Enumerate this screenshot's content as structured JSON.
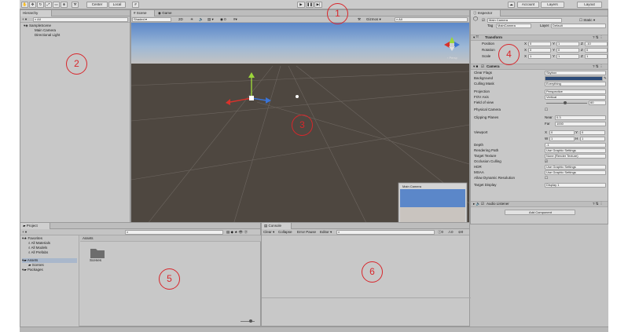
{
  "toolbar": {
    "pivot_label": "Center",
    "space_label": "Local",
    "account_label": "Account",
    "layers_label": "Layers",
    "layout_label": "Layout"
  },
  "hierarchy": {
    "tab_label": "Hierarchy",
    "create_label": "+ ▾",
    "search_placeholder": "All",
    "scene_name": "SampleScene",
    "items": [
      "Main Camera",
      "Directional Light"
    ]
  },
  "scene": {
    "tab_scene": "Scene",
    "tab_game": "Game",
    "shading_mode": "Shaded",
    "mode_2d": "2D",
    "gizmos_label": "Gizmos",
    "search_placeholder": "All",
    "persp_label": "‹ Persp",
    "camera_preview_title": "Main Camera"
  },
  "inspector": {
    "tab_label": "Inspector",
    "object_name": "Main Camera",
    "static_label": "Static",
    "tag_label": "Tag",
    "tag_value": "MainCamera",
    "layer_label": "Layer",
    "layer_value": "Default",
    "transform": {
      "title": "Transform",
      "rows": [
        {
          "label": "Position",
          "x": "0",
          "y": "1",
          "z": "-10"
        },
        {
          "label": "Rotation",
          "x": "0",
          "y": "0",
          "z": "0"
        },
        {
          "label": "Scale",
          "x": "1",
          "y": "1",
          "z": "1"
        }
      ]
    },
    "camera": {
      "title": "Camera",
      "clear_flags_label": "Clear Flags",
      "clear_flags_value": "Skybox",
      "background_label": "Background",
      "background_color": "#2b4a78",
      "culling_mask_label": "Culling Mask",
      "culling_mask_value": "Everything",
      "projection_label": "Projection",
      "projection_value": "Perspective",
      "fov_axis_label": "FOV Axis",
      "fov_axis_value": "Vertical",
      "fov_label": "Field of view",
      "fov_value": "60",
      "physical_camera_label": "Physical Camera",
      "clipping_label": "Clipping Planes",
      "near_label": "Near",
      "near_value": "0.3",
      "far_label": "Far",
      "far_value": "1000",
      "viewport_label": "Viewport",
      "vx_label": "X",
      "vx": "0",
      "vy_label": "Y",
      "vy": "0",
      "vw_label": "W",
      "vw": "1",
      "vh_label": "H",
      "vh": "1",
      "depth_label": "Depth",
      "depth_value": "-1",
      "rendering_path_label": "Rendering Path",
      "rendering_path_value": "Use Graphic Settings",
      "target_texture_label": "Target Texture",
      "target_texture_value": "None (Render Texture)",
      "occlusion_label": "Occlusion Culling",
      "hdr_label": "HDR",
      "hdr_value": "Use Graphic Settings",
      "msaa_label": "MSAA",
      "msaa_value": "Use Graphic Settings",
      "dynamic_res_label": "Allow Dynamic Resolution",
      "target_display_label": "Target Display",
      "target_display_value": "Display 1"
    },
    "audio_listener_title": "Audio Listener",
    "add_component_label": "Add Component"
  },
  "project": {
    "tab_label": "Project",
    "tree": [
      {
        "label": "Favorites",
        "indent": 0
      },
      {
        "label": "All Materials",
        "indent": 1
      },
      {
        "label": "All Models",
        "indent": 1
      },
      {
        "label": "All Prefabs",
        "indent": 1
      },
      {
        "label": "Assets",
        "indent": 0
      },
      {
        "label": "Scenes",
        "indent": 1
      },
      {
        "label": "Packages",
        "indent": 0
      }
    ],
    "assets_header": "Assets",
    "folder_name": "Scenes"
  },
  "console": {
    "tab_label": "Console",
    "clear_label": "Clear",
    "collapse_label": "Collapse",
    "error_pause_label": "Error Pause",
    "editor_label": "Editor",
    "counts": [
      "0",
      "0",
      "0"
    ]
  },
  "annotations": [
    "1",
    "2",
    "3",
    "4",
    "5",
    "6"
  ],
  "colors": {
    "annotation_red": "#d8262b",
    "scene_ground": "#4e4740",
    "sky_top": "#5b87c9"
  }
}
